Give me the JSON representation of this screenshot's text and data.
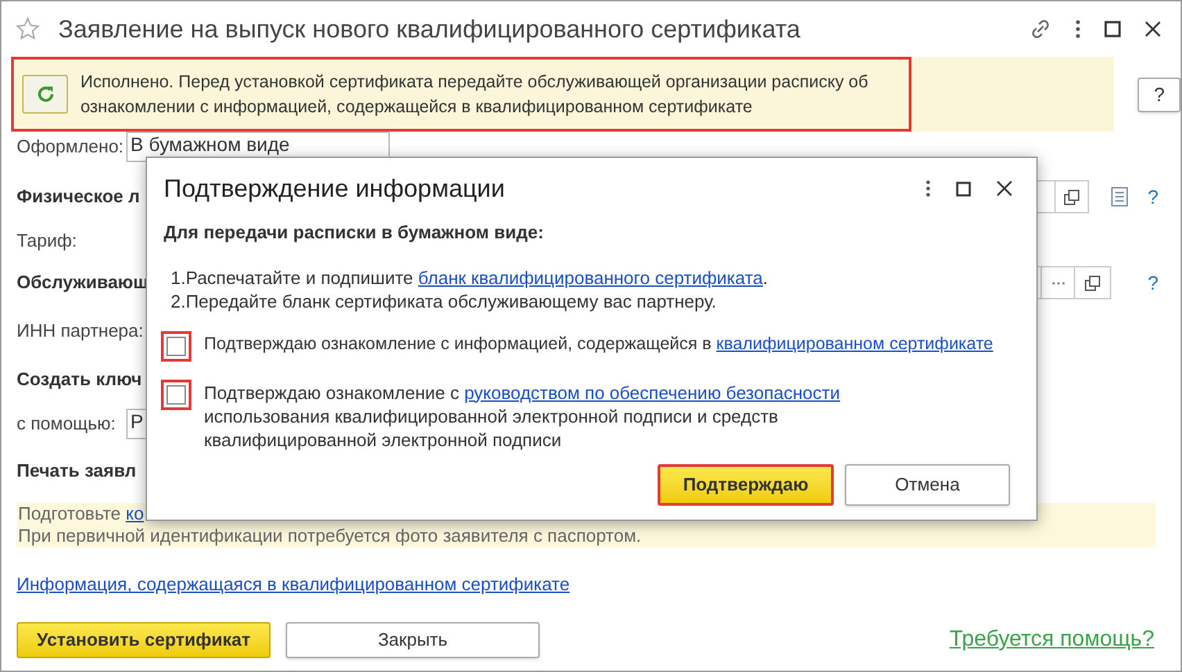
{
  "window": {
    "title": "Заявление на выпуск нового квалифицированного сертификата"
  },
  "banner": {
    "text": "Исполнено. Перед установкой сертификата передайте обслуживающей организации расписку об ознакомлении с информацией, содержащейся в квалифицированном сертификате",
    "highlighted": true
  },
  "help_button": {
    "label": "?"
  },
  "form": [
    {
      "kind": "field",
      "label": "Оформлено:",
      "value": "В бумажном виде"
    },
    {
      "kind": "heading_copy",
      "label": "Физическое л",
      "help": "?"
    },
    {
      "kind": "label",
      "label": "Тариф:"
    },
    {
      "kind": "heading_select",
      "label": "Обслуживающ",
      "help": "?"
    },
    {
      "kind": "label",
      "label": "ИНН партнера:"
    },
    {
      "kind": "heading",
      "label": "Создать ключ"
    },
    {
      "kind": "field",
      "label": "с помощью:",
      "value": "Р"
    },
    {
      "kind": "heading",
      "label": "Печать заявл"
    }
  ],
  "notice": {
    "prefix": "Подготовьте",
    "link": "ко",
    "line_2": "При первичной идентификации потребуется фото заявителя с паспортом."
  },
  "info_link": "Информация, содержащаяся в квалифицированном сертификате",
  "buttons": [
    {
      "label": "Установить сертификат",
      "primary": true
    },
    {
      "label": "Закрыть",
      "primary": false
    }
  ],
  "help_link": "Требуется помощь?",
  "dialog": {
    "title": "Подтверждение информации",
    "subtitle": "Для передачи расписки в бумажном виде:",
    "steps": [
      [
        {
          "text": "1.Распечатайте и подпишите ",
          "link": false
        },
        {
          "text": "бланк квалифицированного сертификата",
          "link": true
        },
        {
          "text": ".",
          "link": false
        }
      ],
      [
        {
          "text": "2.Передайте бланк сертификата обслуживающему вас партнеру.",
          "link": false
        }
      ]
    ],
    "checkboxes": [
      {
        "checked": false,
        "highlighted": true,
        "parts": [
          {
            "text": "Подтверждаю ознакомление с информацией, содержащейся в ",
            "link": false
          },
          {
            "text": "квалифицированном сертификате",
            "link": true
          }
        ]
      },
      {
        "checked": false,
        "highlighted": true,
        "parts": [
          {
            "text": "Подтверждаю ознакомление с ",
            "link": false
          },
          {
            "text": "руководством по обеспечению безопасности",
            "link": true
          },
          {
            "text": " использования квалифицированной электронной подписи и средств квалифицированной электронной подписи",
            "link": false
          }
        ]
      }
    ],
    "buttons": [
      {
        "label": "Подтверждаю",
        "primary": true,
        "highlighted": true
      },
      {
        "label": "Отмена",
        "primary": false,
        "highlighted": false
      }
    ]
  }
}
